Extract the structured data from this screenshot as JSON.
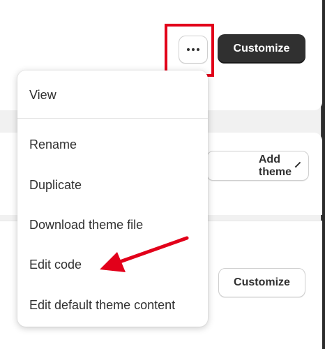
{
  "top_card": {
    "more_actions_label": "more-actions",
    "customize_label": "Customize"
  },
  "library_card": {
    "add_theme_label": "Add theme"
  },
  "theme_card": {
    "customize_label": "Customize"
  },
  "menu": {
    "items": [
      {
        "label": "View"
      },
      {
        "label": "Rename"
      },
      {
        "label": "Duplicate"
      },
      {
        "label": "Download theme file"
      },
      {
        "label": "Edit code"
      },
      {
        "label": "Edit default theme content"
      }
    ]
  },
  "annotation": {
    "highlight_color": "#e2001a",
    "arrow_color": "#e2001a",
    "arrow_target": "Edit code"
  },
  "colors": {
    "primary_button": "#303030",
    "background": "#f1f1f1"
  }
}
